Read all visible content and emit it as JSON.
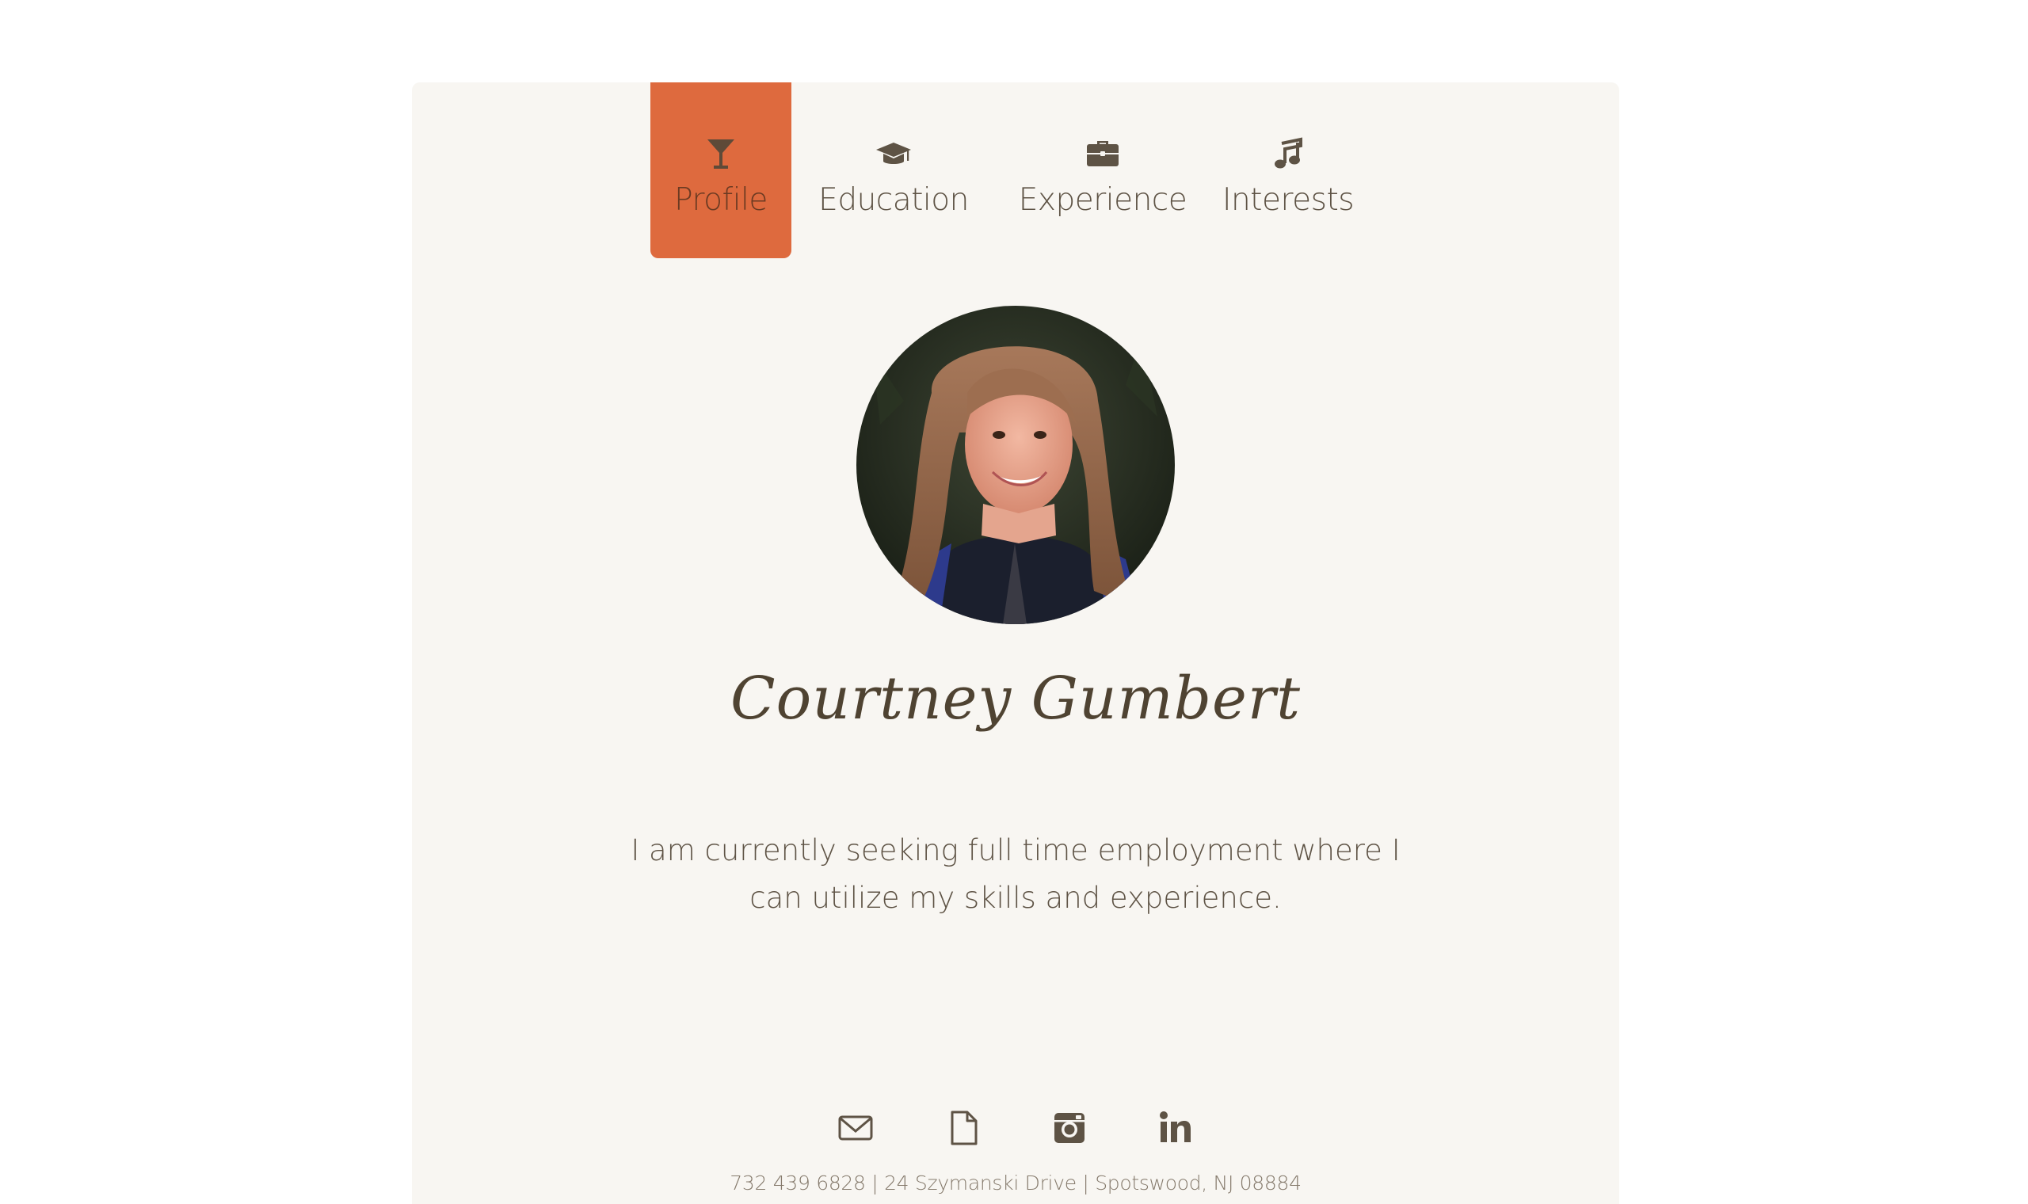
{
  "nav": {
    "tabs": [
      {
        "label": "Profile",
        "icon": "cocktail-icon",
        "active": true
      },
      {
        "label": "Education",
        "icon": "graduation-cap-icon",
        "active": false
      },
      {
        "label": "Experience",
        "icon": "briefcase-icon",
        "active": false
      },
      {
        "label": "Interests",
        "icon": "music-note-icon",
        "active": false
      }
    ]
  },
  "profile": {
    "photo": "profile-photo",
    "name": "Courtney Gumbert",
    "summary": "I am currently seeking full time employment where I can utilize my skills and experience.",
    "socials": [
      {
        "icon": "envelope-icon",
        "name": "email"
      },
      {
        "icon": "document-icon",
        "name": "resume"
      },
      {
        "icon": "instagram-icon",
        "name": "instagram"
      },
      {
        "icon": "linkedin-icon",
        "name": "linkedin"
      }
    ],
    "contact": "732 439 6828 | 24 Szymanski Drive | Spotswood, NJ 08884"
  },
  "colors": {
    "accent": "#de6a3e",
    "card_bg": "#f8f6f2",
    "text": "#5e5345",
    "muted": "#857a6c"
  }
}
